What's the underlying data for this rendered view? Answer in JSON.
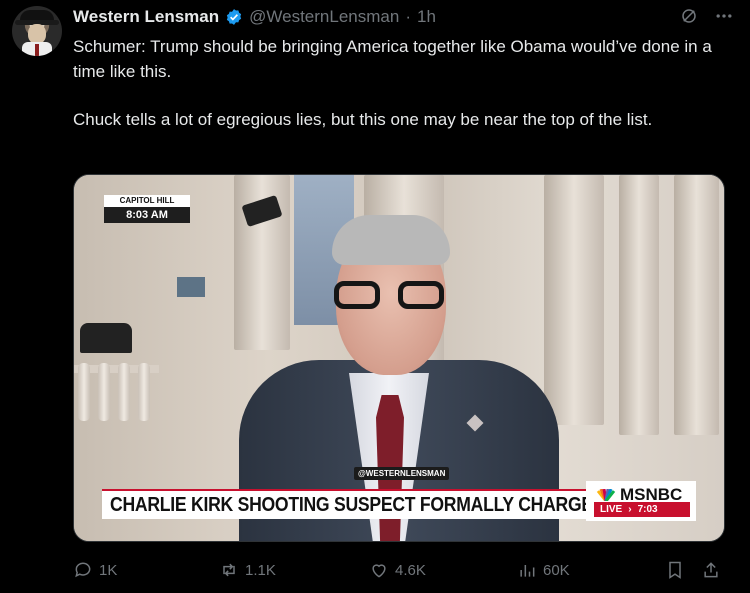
{
  "author": {
    "display_name": "Western Lensman",
    "handle": "@WesternLensman",
    "separator": "·",
    "time": "1h"
  },
  "tweet": {
    "paragraph1": "Schumer: Trump should be bringing America together like Obama would’ve done in a time like this.",
    "paragraph2": "Chuck tells a lot of egregious lies, but this one may be near the top of the list."
  },
  "media": {
    "location_label": "CAPITOL HILL",
    "location_time": "8:03 AM",
    "watermark": "@WESTERNLENSMAN",
    "chyron": "CHARLIE KIRK SHOOTING SUSPECT FORMALLY CHARGED",
    "network": "MSNBC",
    "live_label": "LIVE",
    "live_time": "7:03"
  },
  "actions": {
    "replies": "1K",
    "reposts": "1.1K",
    "likes": "4.6K",
    "views": "60K"
  },
  "colors": {
    "verified": "#1d9bf0",
    "muted": "#71767b",
    "text": "#e7e9ea",
    "chyron_red": "#c8102e"
  },
  "icons": [
    "grok-icon",
    "more-icon",
    "reply-icon",
    "repost-icon",
    "like-icon",
    "views-icon",
    "bookmark-icon",
    "share-icon",
    "verified-badge-icon"
  ]
}
